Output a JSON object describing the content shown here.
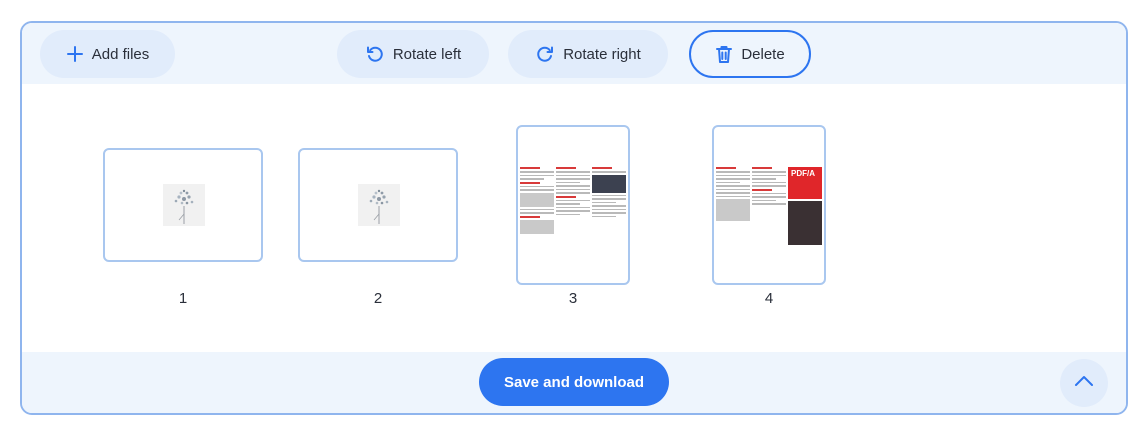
{
  "toolbar": {
    "add_files_label": "Add files",
    "rotate_left_label": "Rotate left",
    "rotate_right_label": "Rotate right",
    "delete_label": "Delete"
  },
  "pages": [
    {
      "number": "1",
      "orientation": "landscape",
      "content": "flower-image"
    },
    {
      "number": "2",
      "orientation": "landscape",
      "content": "flower-image"
    },
    {
      "number": "3",
      "orientation": "portrait",
      "content": "brochure-page"
    },
    {
      "number": "4",
      "orientation": "portrait",
      "content": "brochure-page",
      "badge_text": "PDF/A"
    }
  ],
  "footer": {
    "save_label": "Save and download",
    "scroll_up_icon": "chevron-up-icon"
  },
  "colors": {
    "accent": "#2d75f0",
    "panel_bg": "#eef5fd",
    "button_bg": "#e1ecfb",
    "thumb_border": "#a9c7ef"
  }
}
